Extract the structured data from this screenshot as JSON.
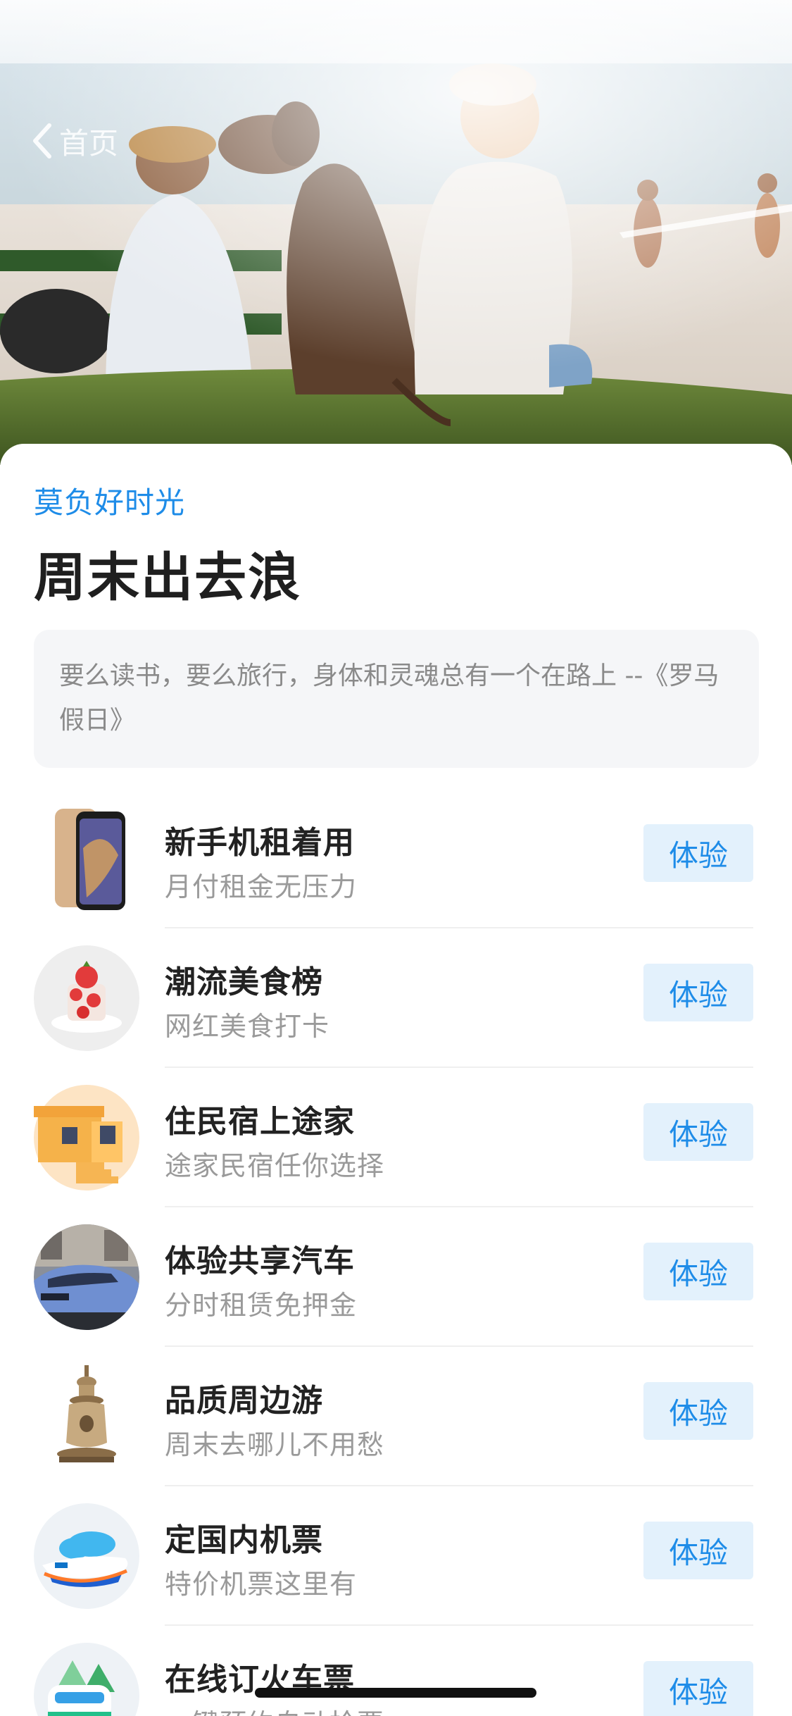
{
  "nav": {
    "back_label": "首页"
  },
  "header": {
    "eyebrow": "莫负好时光",
    "title": "周末出去浪",
    "quote": "要么读书，要么旅行，身体和灵魂总有一个在路上 --《罗马假日》"
  },
  "items": [
    {
      "name": "新手机租着用",
      "desc": "月付租金无压力",
      "button": "体验",
      "icon": "smartphone-icon"
    },
    {
      "name": "潮流美食榜",
      "desc": "网红美食打卡",
      "button": "体验",
      "icon": "strawberry-cake-icon"
    },
    {
      "name": "住民宿上途家",
      "desc": "途家民宿任你选择",
      "button": "体验",
      "icon": "house-icon"
    },
    {
      "name": "体验共享汽车",
      "desc": "分时租赁免押金",
      "button": "体验",
      "icon": "car-icon"
    },
    {
      "name": "品质周边游",
      "desc": "周末去哪儿不用愁",
      "button": "体验",
      "icon": "pagoda-icon"
    },
    {
      "name": "定国内机票",
      "desc": "特价机票这里有",
      "button": "体验",
      "icon": "airplane-icon"
    },
    {
      "name": "在线订火车票",
      "desc": "一键预约自动抢票",
      "button": "体验",
      "icon": "train-icon"
    }
  ],
  "colors": {
    "accent": "#1E8CE8",
    "button_bg": "#E3F1FC"
  }
}
